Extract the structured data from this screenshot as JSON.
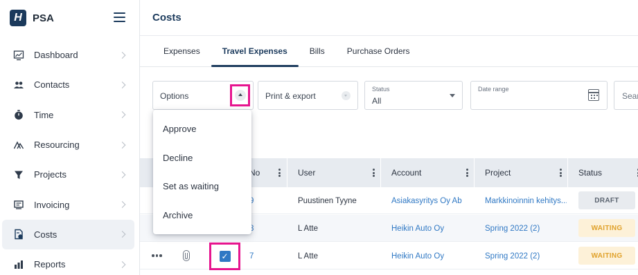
{
  "app": {
    "logo_letter": "H",
    "name": "PSA"
  },
  "sidebar": {
    "items": [
      {
        "label": "Dashboard",
        "icon": "chart-icon"
      },
      {
        "label": "Contacts",
        "icon": "people-icon"
      },
      {
        "label": "Time",
        "icon": "stopwatch-icon"
      },
      {
        "label": "Resourcing",
        "icon": "resourcing-icon"
      },
      {
        "label": "Projects",
        "icon": "funnel-icon"
      },
      {
        "label": "Invoicing",
        "icon": "invoice-icon"
      },
      {
        "label": "Costs",
        "icon": "costs-icon",
        "active": true
      },
      {
        "label": "Reports",
        "icon": "bar-chart-icon"
      }
    ]
  },
  "header": {
    "title": "Costs"
  },
  "tabs": [
    {
      "label": "Expenses"
    },
    {
      "label": "Travel Expenses",
      "active": true
    },
    {
      "label": "Bills"
    },
    {
      "label": "Purchase Orders"
    }
  ],
  "filters": {
    "options_label": "Options",
    "print_label": "Print & export",
    "status_label": "Status",
    "status_value": "All",
    "date_label": "Date range",
    "search_placeholder": "Sear"
  },
  "options_menu": [
    "Approve",
    "Decline",
    "Set as waiting",
    "Archive"
  ],
  "table": {
    "columns": [
      "No",
      "User",
      "Account",
      "Project",
      "Status"
    ],
    "rows": [
      {
        "no": "9",
        "user": "Puustinen Tyyne",
        "account": "Asiakasyritys Oy Ab",
        "project": "Markkinoinnin kehitys...",
        "status": "DRAFT"
      },
      {
        "no": "8",
        "user": "L Atte",
        "account": "Heikin Auto Oy",
        "project": "Spring 2022 (2)",
        "status": "WAITING"
      },
      {
        "no": "7",
        "user": "L Atte",
        "account": "Heikin Auto Oy",
        "project": "Spring 2022 (2)",
        "status": "WAITING",
        "checked": true
      }
    ]
  },
  "colors": {
    "primary": "#1b3a5c",
    "link": "#2f78c4",
    "highlight": "#e6158f",
    "waiting": "#e0a12a"
  }
}
